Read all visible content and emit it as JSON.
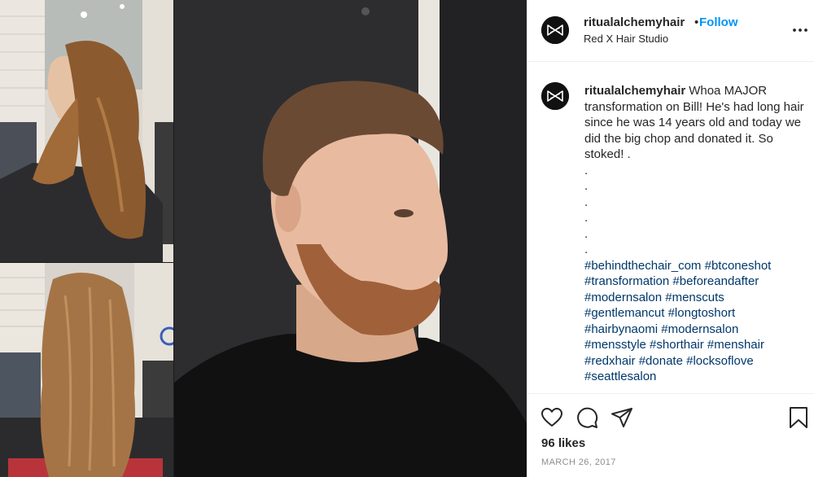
{
  "post": {
    "username": "ritualalchemyhair",
    "separator": "•",
    "follow_label": "Follow",
    "location": "Red X Hair Studio",
    "caption": {
      "username": "ritualalchemyhair",
      "text": "Whoa MAJOR transformation on Bill! He's had long hair since he was 14 years old and today we did the big chop and donated it. So stoked! .",
      "dots": [
        ".",
        ".",
        ".",
        ".",
        ".",
        "."
      ],
      "hashtag_lines": [
        [
          "#behindthechair_com",
          "#btconeshot"
        ],
        [
          "#transformation",
          "#beforeandafter"
        ],
        [
          "#modernsalon",
          "#menscuts"
        ],
        [
          "#gentlemancut",
          "#longtoshort"
        ],
        [
          "#hairbynaomi",
          "#modernsalon"
        ],
        [
          "#mensstyle",
          "#shorthair",
          "#menshair"
        ],
        [
          "#redxhair",
          "#donate",
          "#locksoflove"
        ],
        [
          "#seattlesalon"
        ]
      ]
    },
    "likes": "96 likes",
    "date": "MARCH 26, 2017"
  },
  "icons": {
    "avatar": "bowtie-logo-icon",
    "more": "more-options-icon",
    "like": "heart-icon",
    "comment": "comment-bubble-icon",
    "share": "paper-plane-icon",
    "save": "bookmark-icon"
  },
  "colors": {
    "link_blue": "#0095f6",
    "hashtag": "#00376b",
    "text": "#262626",
    "muted": "#8e8e8e"
  }
}
